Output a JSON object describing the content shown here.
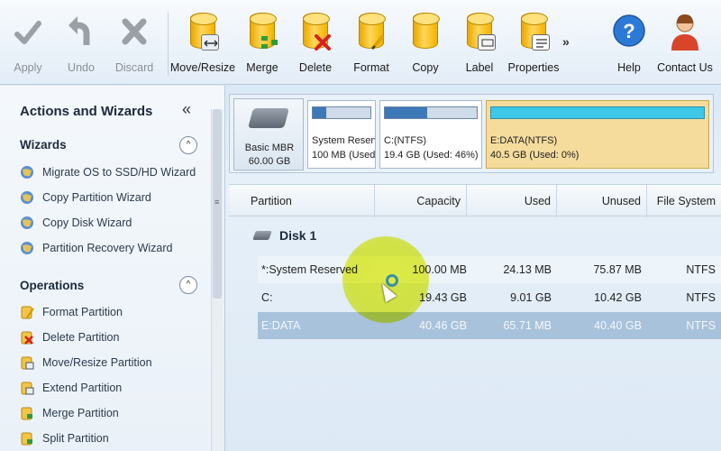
{
  "toolbar": {
    "buttons": [
      {
        "label": "Apply"
      },
      {
        "label": "Undo"
      },
      {
        "label": "Discard"
      },
      {
        "label": "Move/Resize"
      },
      {
        "label": "Merge"
      },
      {
        "label": "Delete"
      },
      {
        "label": "Format"
      },
      {
        "label": "Copy"
      },
      {
        "label": "Label"
      },
      {
        "label": "Properties"
      },
      {
        "label": "Help"
      },
      {
        "label": "Contact Us"
      }
    ],
    "more": "»"
  },
  "left_panel": {
    "title": "Actions and Wizards",
    "collapse": "«",
    "wizards": {
      "title": "Wizards",
      "toggle": "^",
      "items": [
        {
          "label": "Migrate OS to SSD/HD Wizard"
        },
        {
          "label": "Copy Partition Wizard"
        },
        {
          "label": "Copy Disk Wizard"
        },
        {
          "label": "Partition Recovery Wizard"
        }
      ]
    },
    "operations": {
      "title": "Operations",
      "toggle": "^",
      "items": [
        {
          "label": "Format Partition"
        },
        {
          "label": "Delete Partition"
        },
        {
          "label": "Move/Resize Partition"
        },
        {
          "label": "Extend Partition"
        },
        {
          "label": "Merge Partition"
        },
        {
          "label": "Split Partition"
        }
      ]
    }
  },
  "disk_map": {
    "disk_type": "Basic MBR",
    "disk_size": "60.00 GB",
    "partitions": [
      {
        "name": "System Reserv",
        "size": "100 MB (Used:",
        "used_fraction": 0.24
      },
      {
        "name": "C:(NTFS)",
        "size": "19.4 GB (Used: 46%)",
        "used_fraction": 0.46
      },
      {
        "name": "E:DATA(NTFS)",
        "size": "40.5 GB (Used: 0%)",
        "used_fraction": 0.0
      }
    ]
  },
  "table": {
    "columns": [
      "Partition",
      "Capacity",
      "Used",
      "Unused",
      "File System"
    ],
    "disk_label": "Disk 1",
    "rows": [
      {
        "partition": "*:System Reserved",
        "capacity": "100.00 MB",
        "used": "24.13 MB",
        "unused": "75.87 MB",
        "fs": "NTFS"
      },
      {
        "partition": "C:",
        "capacity": "19.43 GB",
        "used": "9.01 GB",
        "unused": "10.42 GB",
        "fs": "NTFS"
      },
      {
        "partition": "E:DATA",
        "capacity": "40.46 GB",
        "used": "65.71 MB",
        "unused": "40.40 GB",
        "fs": "NTFS"
      }
    ]
  }
}
